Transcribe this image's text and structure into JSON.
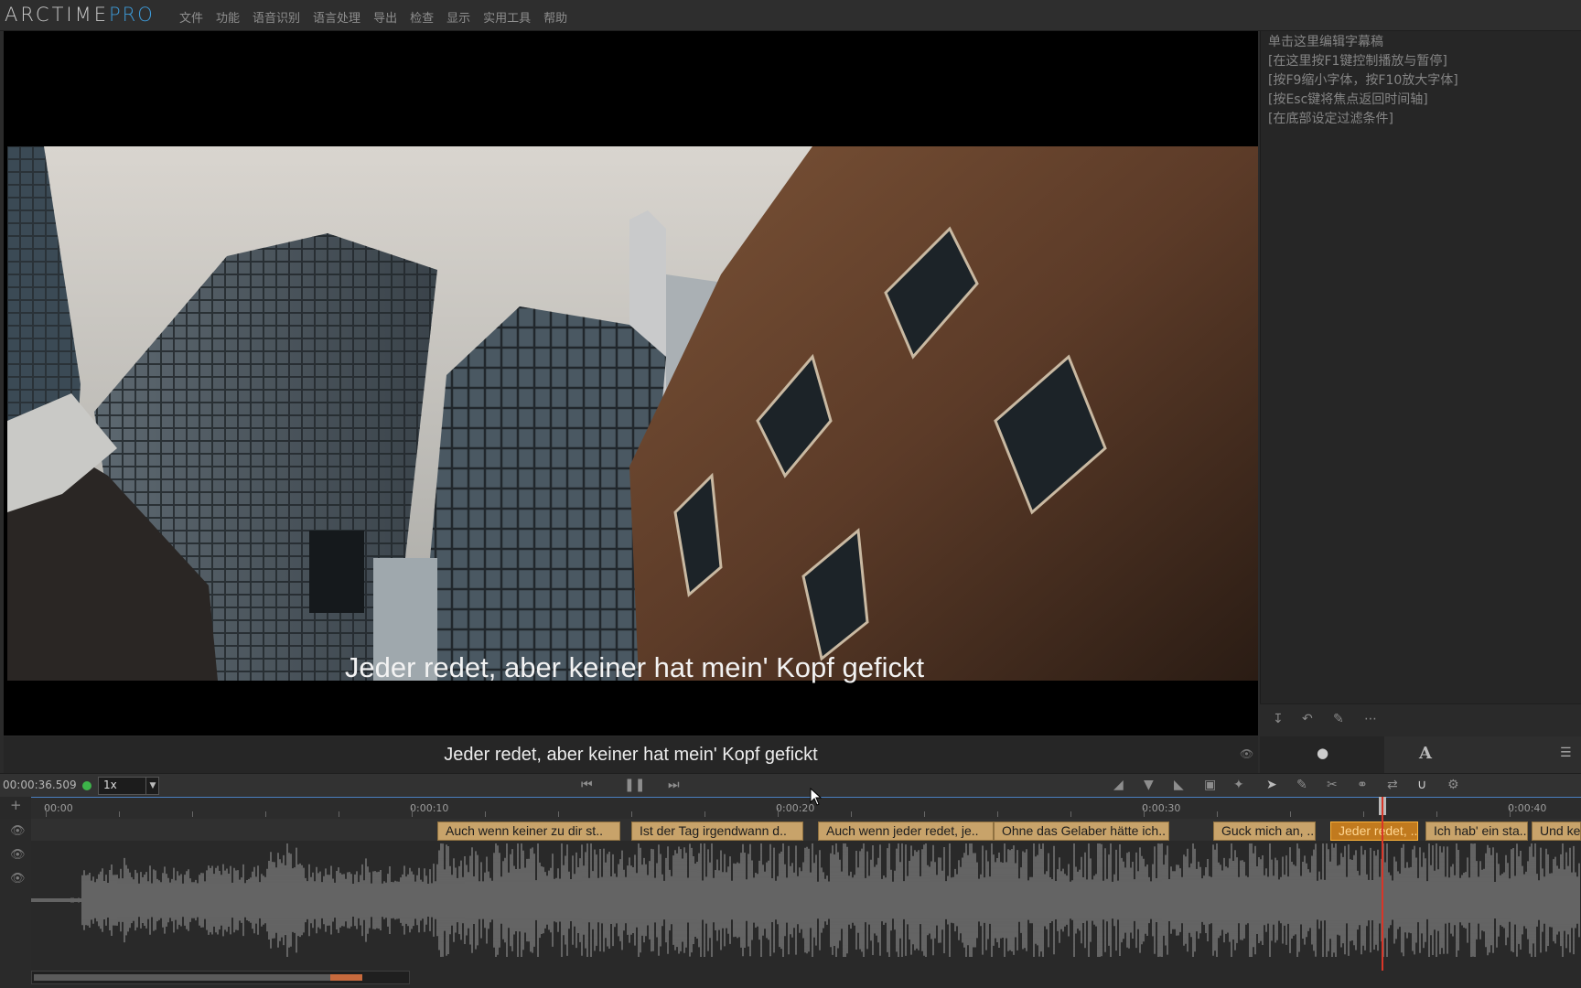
{
  "app": {
    "brand": "ARCTIME",
    "brand_pro": "PRO"
  },
  "menu": [
    "文件",
    "功能",
    "语音识别",
    "语言处理",
    "导出",
    "检查",
    "显示",
    "实用工具",
    "帮助"
  ],
  "video": {
    "subtitle": "Jeder redet, aber keiner hat mein' Kopf gefickt"
  },
  "subtitle_bar": {
    "text": "Jeder redet, aber keiner hat mein' Kopf gefickt"
  },
  "script_panel": {
    "lines": [
      "单击这里编辑字幕稿",
      "[在这里按F1键控制播放与暂停]",
      "[按F9缩小字体，按F10放大字体]",
      "[按Esc键将焦点返回时间轴]",
      "[在底部设定过滤条件]"
    ]
  },
  "right_tabs": {
    "style_label": "A"
  },
  "transport": {
    "timecode": "00:00:36.509",
    "speed": "1x"
  },
  "ruler": {
    "labels": [
      "00:00",
      "0:00:10",
      "0:00:20",
      "0:00:30",
      "0:00:40"
    ]
  },
  "timeline": {
    "clips": [
      {
        "text": "Auch wenn keiner zu dir st..",
        "start_s": 10.7,
        "end_s": 15.7
      },
      {
        "text": "Ist der Tag irgendwann d..",
        "start_s": 16.0,
        "end_s": 20.7
      },
      {
        "text": "Auch wenn jeder redet, je..",
        "start_s": 21.1,
        "end_s": 25.9
      },
      {
        "text": "Ohne das Gelaber hätte ich..",
        "start_s": 25.9,
        "end_s": 30.7
      },
      {
        "text": "Guck mich an, ..",
        "start_s": 31.9,
        "end_s": 34.7
      },
      {
        "text": "Jeder redet, ..",
        "start_s": 35.1,
        "end_s": 37.5,
        "selected": true
      },
      {
        "text": "Ich hab' ein sta..",
        "start_s": 37.7,
        "end_s": 40.5
      },
      {
        "text": "Und keiner",
        "start_s": 40.6,
        "end_s": 43.0
      }
    ],
    "playhead_s": 36.5,
    "scroll_position": 0.87
  }
}
